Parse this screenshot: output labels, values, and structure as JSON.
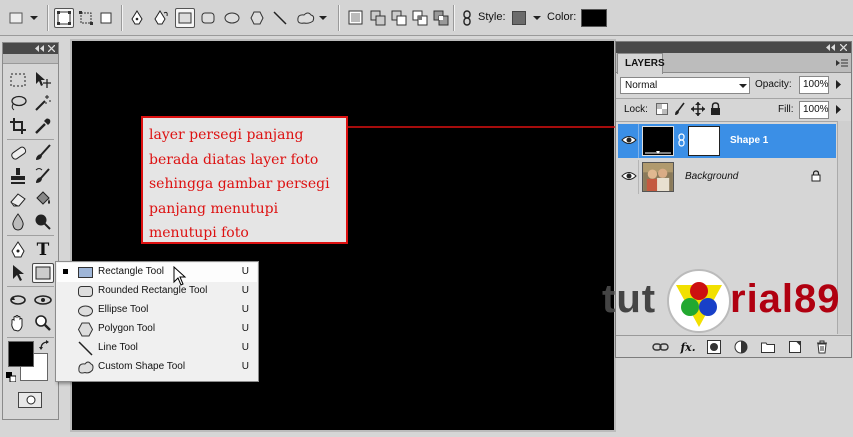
{
  "options_bar": {
    "style_label": "Style:",
    "color_label": "Color:",
    "style_swatch_color": "#6b6b6b",
    "color_swatch_color": "#000000"
  },
  "annotation": {
    "text": "layer persegi panjang\nberada diatas layer foto\nsehingga gambar persegi\npanjang menutupi\nmenutupi foto",
    "color": "#d11111"
  },
  "flyout_menu": {
    "items": [
      {
        "label": "Rectangle Tool",
        "key": "U",
        "icon": "rectangle-shape-icon",
        "current": true
      },
      {
        "label": "Rounded Rectangle Tool",
        "key": "U",
        "icon": "rounded-rectangle-icon",
        "current": false
      },
      {
        "label": "Ellipse Tool",
        "key": "U",
        "icon": "ellipse-icon",
        "current": false
      },
      {
        "label": "Polygon Tool",
        "key": "U",
        "icon": "polygon-icon",
        "current": false
      },
      {
        "label": "Line Tool",
        "key": "U",
        "icon": "line-icon",
        "current": false
      },
      {
        "label": "Custom Shape Tool",
        "key": "U",
        "icon": "custom-shape-icon",
        "current": false
      }
    ]
  },
  "layers_panel": {
    "tab_label": "LAYERS",
    "blend_mode": "Normal",
    "opacity_label": "Opacity:",
    "opacity_value": "100%",
    "lock_label": "Lock:",
    "fill_label": "Fill:",
    "fill_value": "100%",
    "layers": [
      {
        "name": "Shape 1",
        "selected": true
      },
      {
        "name": "Background",
        "selected": false,
        "locked": true
      }
    ],
    "selection_color": "#3b8fe6"
  },
  "watermark": {
    "left_text": "tut",
    "right_text": "rial89"
  },
  "colors": {
    "foreground": "#000000",
    "background": "#ffffff",
    "canvas": "#000000"
  }
}
